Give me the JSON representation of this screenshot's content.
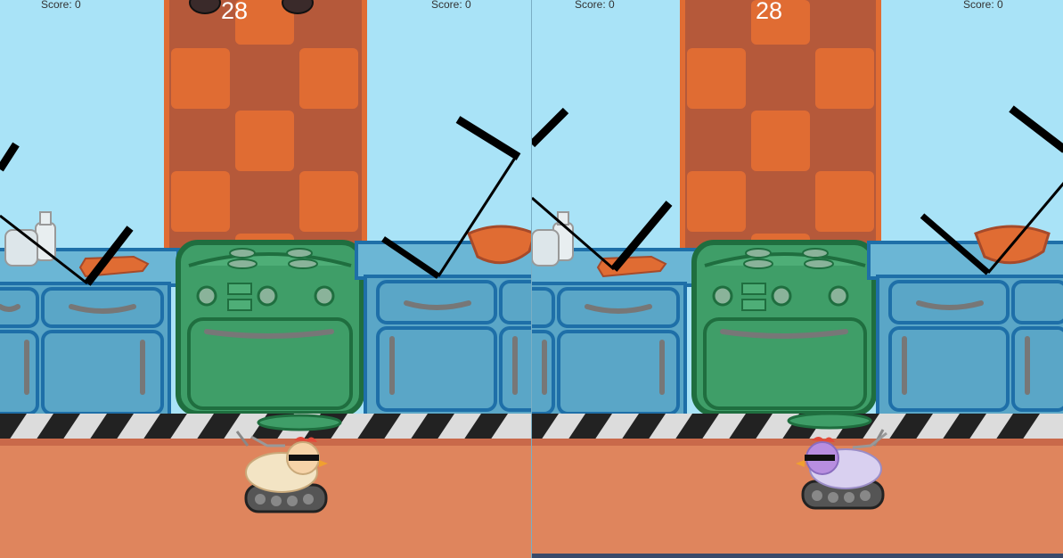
{
  "game": {
    "screens": [
      {
        "id": "left",
        "score_left": "Score: 0",
        "score_right": "Score: 0",
        "timer": "28"
      },
      {
        "id": "right",
        "score_left": "Score: 0",
        "score_right": "Score: 0",
        "timer": "28"
      }
    ]
  },
  "colors": {
    "sky": "#a9e3f7",
    "wall_orange": "#e06c33",
    "wall_brown": "#b5593a",
    "cabinet_blue": "#5aa6c7",
    "cabinet_outline": "#1e6fa8",
    "stove_green": "#3f9e68",
    "stove_outline": "#1f6e3f",
    "floor": "#df855d"
  },
  "icons": [
    "chicken-tank-icon",
    "frying-pan-icon",
    "bowl-icon",
    "bottle-icon",
    "cutting-board-icon"
  ]
}
